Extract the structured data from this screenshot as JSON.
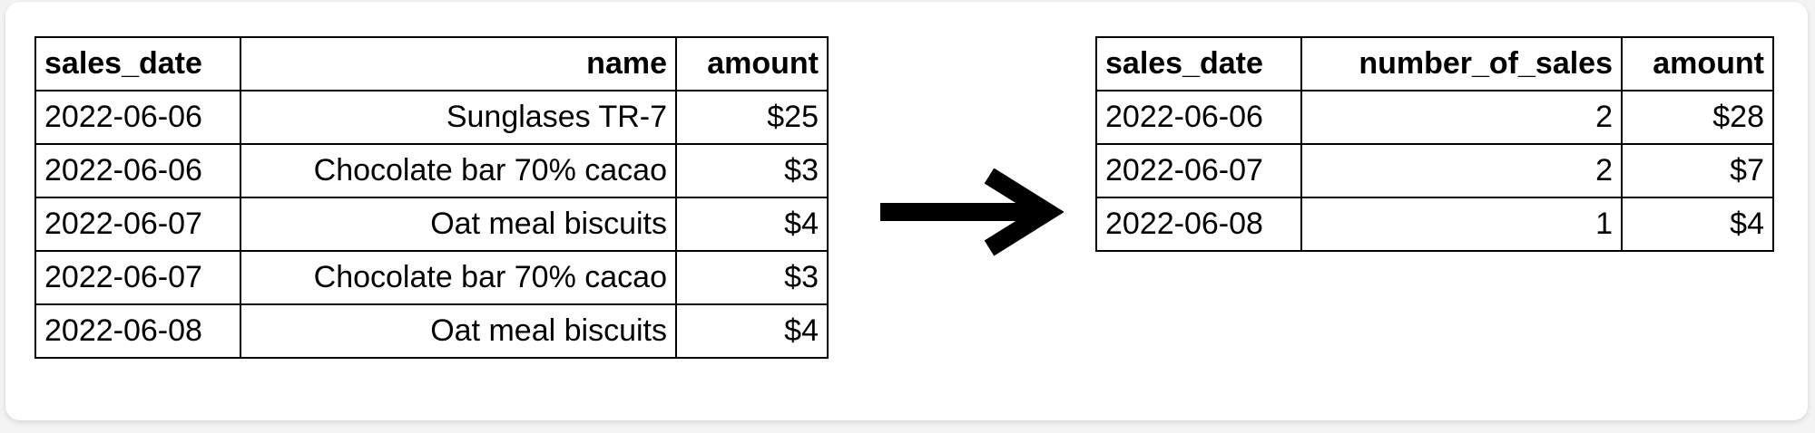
{
  "left_table": {
    "headers": [
      "sales_date",
      "name",
      "amount"
    ],
    "rows": [
      [
        "2022-06-06",
        "Sunglases TR-7",
        "$25"
      ],
      [
        "2022-06-06",
        "Chocolate bar 70% cacao",
        "$3"
      ],
      [
        "2022-06-07",
        "Oat meal biscuits",
        "$4"
      ],
      [
        "2022-06-07",
        "Chocolate bar 70% cacao",
        "$3"
      ],
      [
        "2022-06-08",
        "Oat meal biscuits",
        "$4"
      ]
    ]
  },
  "arrow": {
    "icon": "arrow-right-icon"
  },
  "right_table": {
    "headers": [
      "sales_date",
      "number_of_sales",
      "amount"
    ],
    "rows": [
      [
        "2022-06-06",
        "2",
        "$28"
      ],
      [
        "2022-06-07",
        "2",
        "$7"
      ],
      [
        "2022-06-08",
        "1",
        "$4"
      ]
    ]
  }
}
